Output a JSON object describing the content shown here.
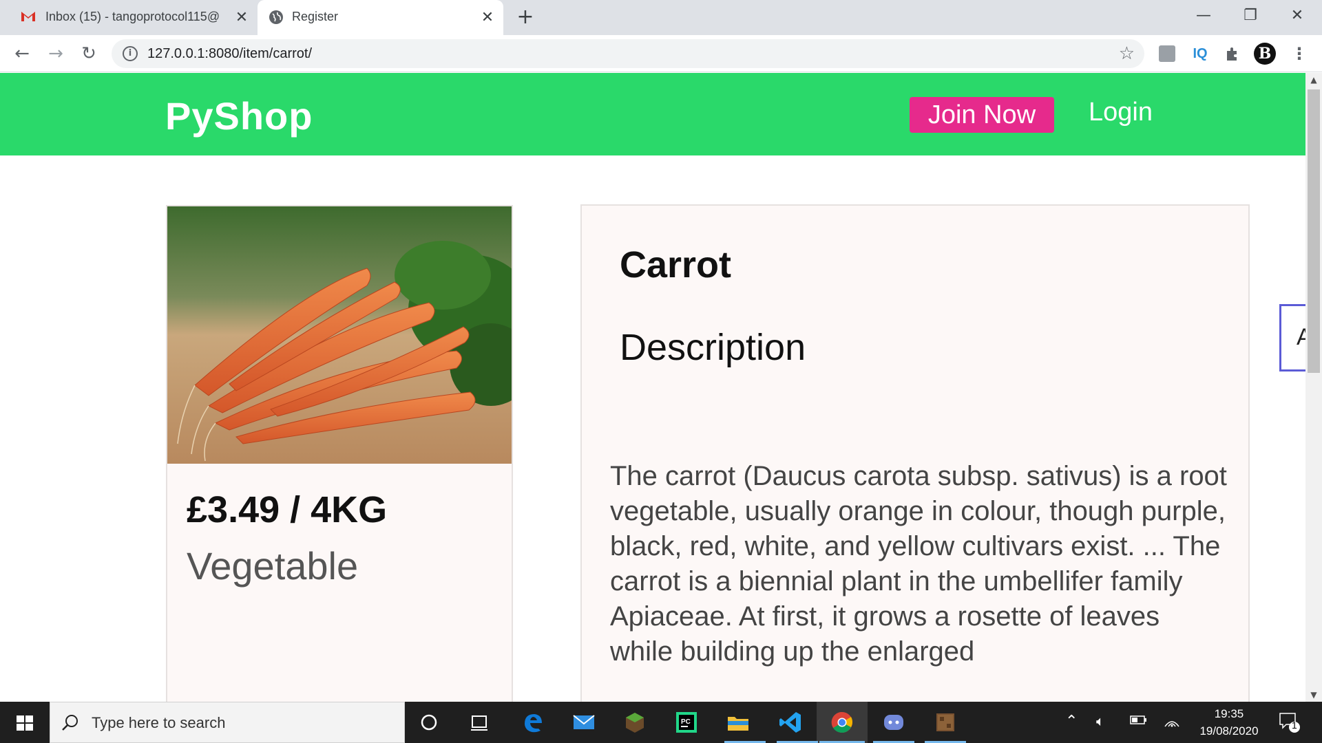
{
  "browser": {
    "tabs": [
      {
        "title": "Inbox (15) - tangoprotocol115@",
        "active": false
      },
      {
        "title": "Register",
        "active": true
      }
    ],
    "url": "127.0.0.1:8080/item/carrot/"
  },
  "site": {
    "brand": "PyShop",
    "nav": {
      "join_label": "Join Now",
      "login_label": "Login"
    },
    "colors": {
      "header": "#2ad96a",
      "join_button": "#e62a8c"
    }
  },
  "product": {
    "name": "Carrot",
    "price": "£3.49 / 4KG",
    "category": "Vegetable",
    "description_heading": "Description",
    "description": "The carrot (Daucus carota subsp. sativus) is a root vegetable, usually orange in colour, though purple, black, red, white, and yellow cultivars exist. ... The carrot is a biennial plant in the umbellifer family Apiaceae. At first, it grows a rosette of leaves while building up the enlarged"
  },
  "side_widget": {
    "label": "A"
  },
  "taskbar": {
    "search_placeholder": "Type here to search",
    "time": "19:35",
    "date": "19/08/2020",
    "notification_count": "1"
  }
}
